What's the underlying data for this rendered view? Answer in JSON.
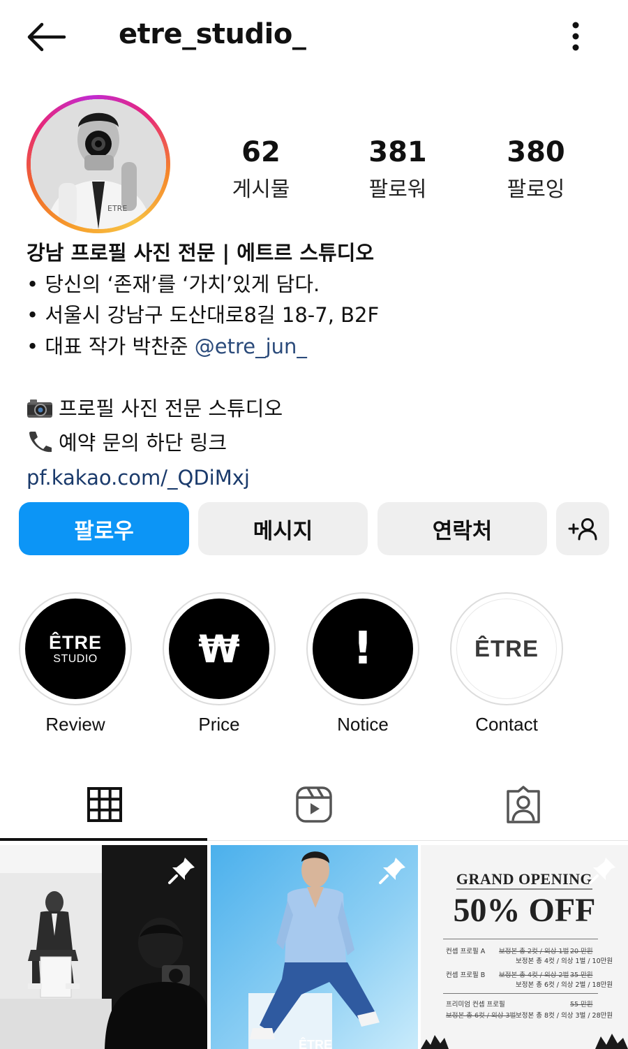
{
  "header": {
    "username": "etre_studio_"
  },
  "stats": [
    {
      "value": "62",
      "label": "게시물"
    },
    {
      "value": "381",
      "label": "팔로워"
    },
    {
      "value": "380",
      "label": "팔로잉"
    }
  ],
  "bio": {
    "name": "강남 프로필 사진 전문 | 에트르 스튜디오",
    "line1": "• 당신의 ‘존재’를 ‘가치’있게 담다.",
    "line2": "• 서울시 강남구 도산대로8길 18-7, B2F",
    "line3_prefix": "• 대표 작가 박찬준 ",
    "line3_mention": "@etre_jun_",
    "line4": "프로필 사진 전문 스튜디오",
    "line5": "예약 문의 하단 링크",
    "link": "pf.kakao.com/_QDiMxj"
  },
  "actions": {
    "follow": "팔로우",
    "message": "메시지",
    "contact": "연락처"
  },
  "highlights": [
    {
      "label": "Review",
      "cover_text_1": "ÊTRE",
      "cover_text_2": "STUDIO"
    },
    {
      "label": "Price",
      "cover_text_1": "₩"
    },
    {
      "label": "Notice",
      "cover_text_1": "!"
    },
    {
      "label": "Contact",
      "cover_text_1": "ÊTRE"
    }
  ],
  "posts": {
    "post2_watermark": "ÊTRE",
    "promo": {
      "title": "GRAND OPENING",
      "headline": "50% OFF",
      "r1_name": "컨셉 프로필 A",
      "r1_old": "보정본 총 2컷 / 의상 1벌",
      "r1_old_price": "20 만원",
      "r1_new": "보정본 총 4컷 / 의상 1벌 / 10만원",
      "r2_name": "컨셉 프로필 B",
      "r2_old": "보정본 총 4컷 / 의상 2벌",
      "r2_old_price": "35 만원",
      "r2_new": "보정본 총 6컷 / 의상 2벌 / 18만원",
      "r3_name": "프리미엄 컨셉 프로필",
      "r3_old_price": "55 만원",
      "r3_old": "보정본 총 6컷 / 의상 3벌",
      "r3_new": "보정본 총 8컷 / 의상 3벌 / 28만원"
    }
  },
  "colors": {
    "follow_blue": "#0c95f6",
    "mention": "#2a4a7a"
  }
}
